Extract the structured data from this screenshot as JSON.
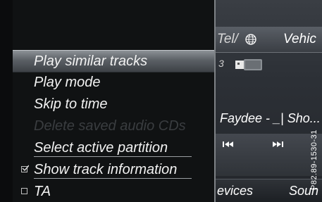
{
  "background": {
    "tabs": {
      "tel": "Tel/",
      "vehicle": "Vehic"
    },
    "track_number": "3",
    "now_playing": "Faydee - _| Sho...",
    "bottom": {
      "devices": "evices",
      "sound": "Soun"
    }
  },
  "menu": {
    "items": [
      {
        "label": "Play similar tracks",
        "state": "selected"
      },
      {
        "label": "Play mode",
        "state": "normal"
      },
      {
        "label": "Skip to time",
        "state": "normal"
      },
      {
        "label": "Delete saved audio CDs",
        "state": "disabled"
      },
      {
        "label": "Select active partition",
        "state": "normal"
      },
      {
        "label": "Show track information",
        "state": "checked"
      },
      {
        "label": "TA",
        "state": "unchecked"
      }
    ]
  },
  "figure_ref": "P82.89-1530-31",
  "colors": {
    "menu_bg": "#101213",
    "highlight": "#6b7075",
    "disabled_text": "#3a3d40",
    "text": "#f2f2f2"
  }
}
